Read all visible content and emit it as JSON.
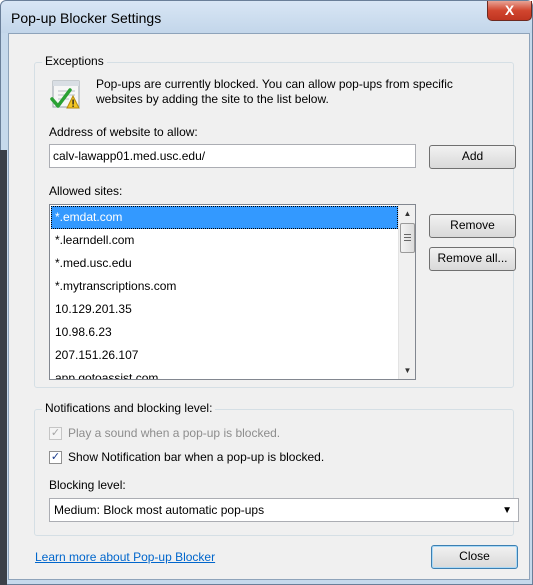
{
  "window": {
    "title": "Pop-up Blocker Settings",
    "close_glyph": "X"
  },
  "exceptions": {
    "legend": "Exceptions",
    "info_text": "Pop-ups are currently blocked.  You can allow pop-ups from specific websites by adding the site to the list below.",
    "icon": "settings-check-icon",
    "address_label": "Address of website to allow:",
    "address_value": "calv-lawapp01.med.usc.edu/",
    "add_button": "Add",
    "allowed_label": "Allowed sites:",
    "allowed_sites": [
      "*.emdat.com",
      "*.learndell.com",
      "*.med.usc.edu",
      "*.mytranscriptions.com",
      "10.129.201.35",
      "10.98.6.23",
      "207.151.26.107",
      "app.gotoassist.com"
    ],
    "selected_index": 0,
    "remove_button": "Remove",
    "remove_all_button": "Remove all..."
  },
  "notifications": {
    "legend": "Notifications and blocking level:",
    "play_sound_label": "Play a sound when a pop-up is blocked.",
    "play_sound_checked": true,
    "play_sound_enabled": false,
    "show_bar_label": "Show Notification bar when a pop-up is blocked.",
    "show_bar_checked": true,
    "blocking_label": "Blocking level:",
    "blocking_value": "Medium: Block most automatic pop-ups"
  },
  "footer": {
    "learn_more_link": "Learn more about Pop-up Blocker",
    "close_button": "Close"
  },
  "colors": {
    "selection": "#3399ff",
    "link": "#0066cc",
    "close_button_red": "#c03521"
  }
}
